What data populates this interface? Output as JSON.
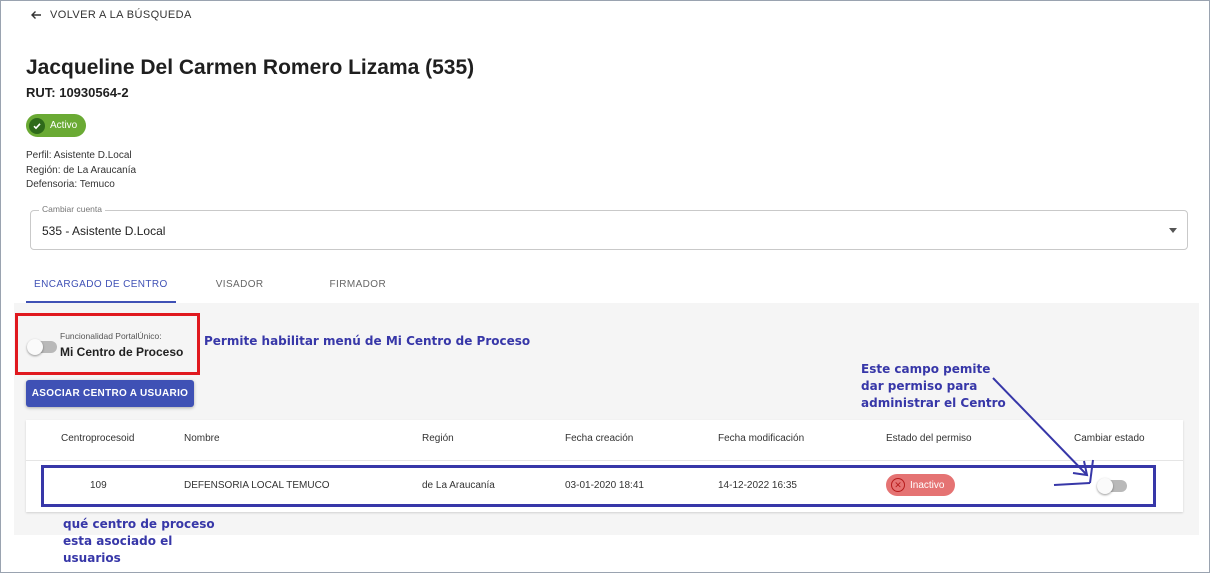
{
  "nav": {
    "back_label": "VOLVER A LA BÚSQUEDA"
  },
  "user": {
    "name": "Jacqueline Del Carmen Romero Lizama (535)",
    "rut": "RUT: 10930564-2",
    "status": "Activo",
    "perfil": "Perfil: Asistente D.Local",
    "region": "Región: de La Araucanía",
    "defensoria": "Defensoria: Temuco"
  },
  "account_select": {
    "label": "Cambiar cuenta",
    "value": "535 - Asistente D.Local"
  },
  "tabs": [
    {
      "label": "ENCARGADO DE CENTRO",
      "active": true
    },
    {
      "label": "VISADOR",
      "active": false
    },
    {
      "label": "FIRMADOR",
      "active": false
    }
  ],
  "functionality": {
    "small_label": "Funcionalidad PortalÚnico:",
    "title": "Mi Centro de Proceso",
    "enabled": false
  },
  "annotations": {
    "menu": "Permite habilitar menú de Mi Centro de Proceso",
    "permiso": [
      "Este campo pemite",
      "dar permiso para",
      "administrar el Centro"
    ],
    "centro": [
      "qué centro de proceso",
      "esta asociado el",
      "usuarios"
    ]
  },
  "assoc_button": "ASOCIAR CENTRO A USUARIO",
  "table": {
    "headers": [
      "Centroprocesoid",
      "Nombre",
      "Región",
      "Fecha creación",
      "Fecha modificación",
      "Estado del permiso",
      "Cambiar estado"
    ],
    "rows": [
      {
        "id": "109",
        "nombre": "DEFENSORIA LOCAL TEMUCO",
        "region": "de La Araucanía",
        "creacion": "03-01-2020 18:41",
        "modificacion": "14-12-2022 16:35",
        "estado": "Inactivo",
        "toggle_on": false
      }
    ]
  },
  "colors": {
    "primary": "#3f51b5",
    "active_chip": "#6aaa34",
    "inactive_chip": "#e57373",
    "annotation": "#3737a8",
    "highlight_red": "#e0191f"
  }
}
